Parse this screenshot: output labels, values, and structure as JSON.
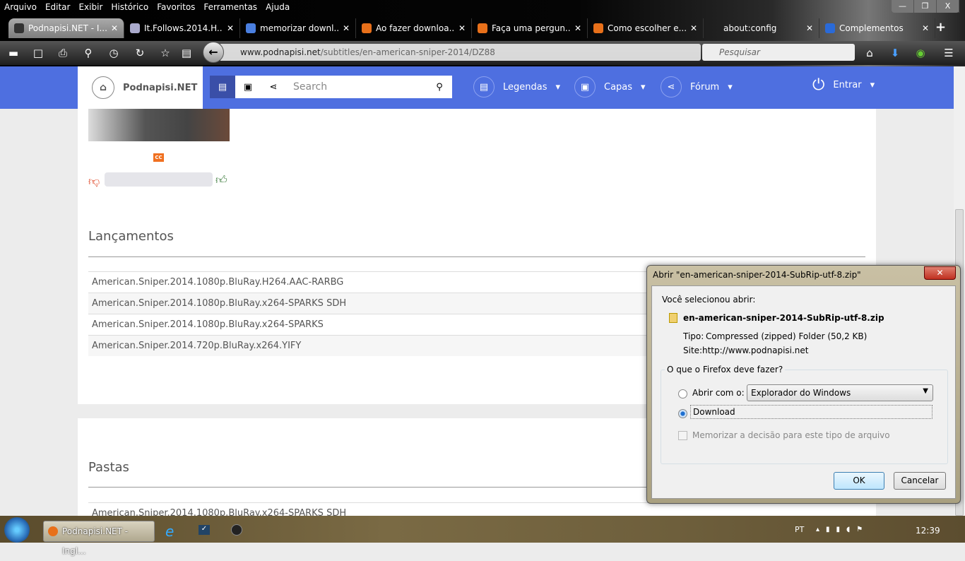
{
  "menu": [
    "Arquivo",
    "Editar",
    "Exibir",
    "Histórico",
    "Favoritos",
    "Ferramentas",
    "Ajuda"
  ],
  "tabs": [
    {
      "title": "Podnapisi.NET - I...",
      "active": true,
      "icon_color": "#333"
    },
    {
      "title": "It.Follows.2014.H...",
      "icon_color": "#aac"
    },
    {
      "title": "memorizar downl...",
      "icon_color": "#4a7fe0"
    },
    {
      "title": "Ao fazer downloa...",
      "icon_color": "#e8701a"
    },
    {
      "title": "Faça uma pergun...",
      "icon_color": "#e8701a"
    },
    {
      "title": "Como escolher e...",
      "icon_color": "#e8701a"
    },
    {
      "title": "about:config",
      "icon_color": "transparent"
    },
    {
      "title": "Complementos",
      "icon_color": "#2a6ad8"
    }
  ],
  "url": {
    "domain": "www.podnapisi.net",
    "path": "/subtitles/en-american-sniper-2014/DZ88"
  },
  "search_placeholder": "Pesquisar",
  "site": {
    "brand": "Podnapisi.NET",
    "search_placeholder": "Search",
    "nav": [
      "Legendas",
      "Capas",
      "Fórum",
      "Entrar"
    ],
    "accent": "#4e6fe0"
  },
  "cc_badge": "CC",
  "releases": {
    "heading": "Lançamentos",
    "items": [
      "American.Sniper.2014.1080p.BluRay.H264.AAC-RARBG",
      "American.Sniper.2014.1080p.BluRay.x264-SPARKS SDH",
      "American.Sniper.2014.1080p.BluRay.x264-SPARKS",
      "American.Sniper.2014.720p.BluRay.x264.YIFY"
    ]
  },
  "folders": {
    "heading": "Pastas",
    "items": [
      "American.Sniper.2014.1080p.BluRay.x264-SPARKS SDH"
    ]
  },
  "dialog": {
    "title": "Abrir \"en-american-sniper-2014-SubRip-utf-8.zip\"",
    "intro": "Você selecionou abrir:",
    "filename": "en-american-sniper-2014-SubRip-utf-8.zip",
    "type_label": "Tipo:",
    "type_value": "Compressed (zipped) Folder (50,2 KB)",
    "site_label": "Site:",
    "site_value": "http://www.podnapisi.net",
    "group_label": "O que o Firefox deve fazer?",
    "open_with": "Abrir com o:",
    "open_with_app": "Explorador do Windows",
    "download": "Download",
    "remember": "Memorizar a decisão para este tipo de arquivo",
    "ok": "OK",
    "cancel": "Cancelar"
  },
  "taskbar": {
    "item": "Podnapisi.NET - Ingl...",
    "lang": "PT",
    "time": "12:39"
  }
}
